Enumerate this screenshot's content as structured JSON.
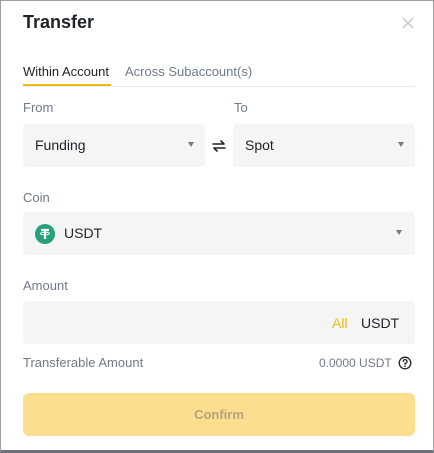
{
  "dialog": {
    "title": "Transfer",
    "close_icon": "close-icon"
  },
  "tabs": [
    {
      "label": "Within Account",
      "active": true
    },
    {
      "label": "Across Subaccount(s)",
      "active": false
    }
  ],
  "from": {
    "label": "From",
    "value": "Funding"
  },
  "to": {
    "label": "To",
    "value": "Spot"
  },
  "swap_icon": "swap-arrows-icon",
  "coin": {
    "label": "Coin",
    "value": "USDT",
    "icon": "tether-icon"
  },
  "amount": {
    "label": "Amount",
    "value": "",
    "placeholder": "",
    "all_label": "All",
    "unit": "USDT"
  },
  "transferable": {
    "label": "Transferable Amount",
    "value": "0.0000 USDT",
    "help_icon": "help-circle-icon"
  },
  "confirm": {
    "label": "Confirm",
    "enabled": false
  },
  "colors": {
    "accent": "#f0b90b",
    "confirm_disabled_bg": "#fbdf8e",
    "field_bg": "#f5f5f5",
    "tether_green": "#26a17b",
    "muted_text": "#707a8a"
  }
}
